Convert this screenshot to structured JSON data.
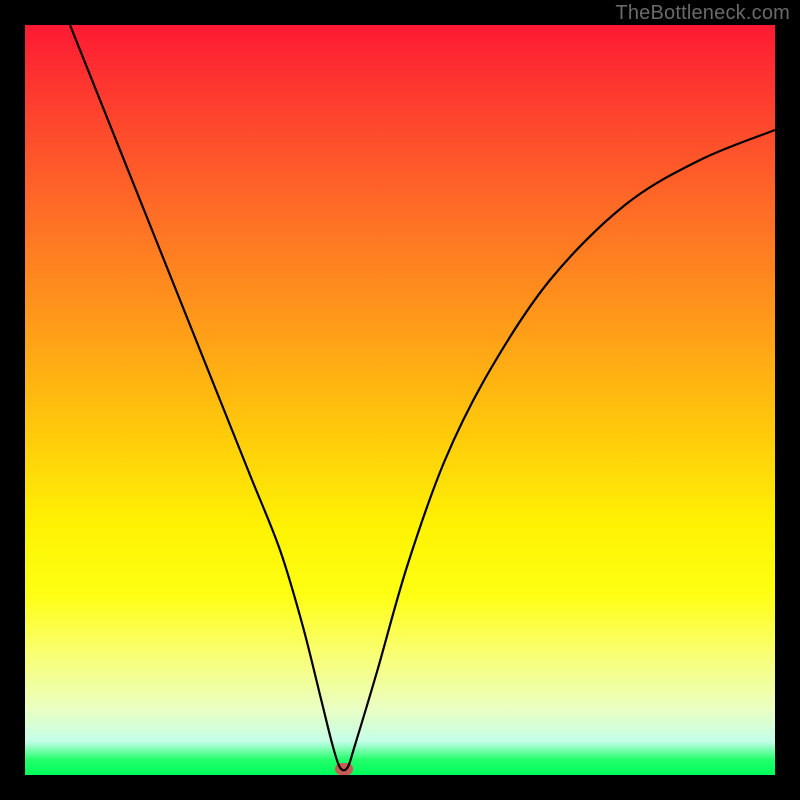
{
  "watermark": "TheBottleneck.com",
  "chart_data": {
    "type": "line",
    "title": "",
    "xlabel": "",
    "ylabel": "",
    "xlim": [
      0,
      100
    ],
    "ylim": [
      0,
      100
    ],
    "grid": false,
    "legend": false,
    "series": [
      {
        "name": "bottleneck-curve",
        "x": [
          6,
          10,
          14,
          18,
          22,
          26,
          30,
          34,
          37,
          39.5,
          41,
          42,
          43,
          44,
          47,
          51,
          56,
          62,
          70,
          80,
          90,
          100
        ],
        "values": [
          100,
          90,
          80,
          70,
          60,
          50,
          40,
          30,
          20,
          10,
          4,
          1,
          1,
          4,
          14,
          28,
          42,
          54,
          66,
          76,
          82,
          86
        ]
      }
    ],
    "marker": {
      "x": 42.5,
      "y": 0.8,
      "color": "#c75c54"
    },
    "curve_color": "#000000"
  }
}
